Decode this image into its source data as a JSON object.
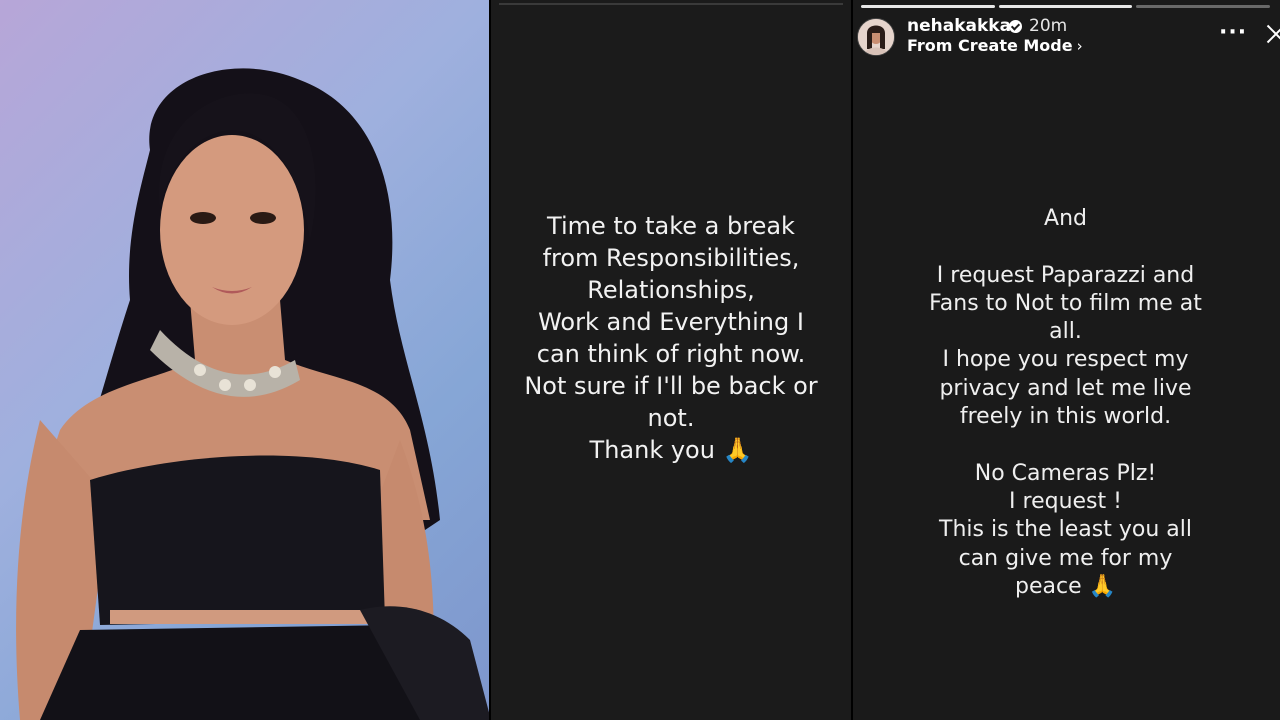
{
  "photo": {
    "alt": "portrait photo of woman in black strapless outfit"
  },
  "story_left": {
    "text": "Time to take a break\nfrom Responsibilities,\nRelationships,\nWork and Everything I\ncan think of right now.\nNot sure if I'll be back or\nnot.\nThank you 🙏"
  },
  "story_right": {
    "username": "nehakakkar",
    "time_ago": "20m",
    "sub_label": "From Create Mode",
    "chevron": "›",
    "more_label": "···",
    "text": "And\n\nI request Paparazzi and\nFans to Not to film me at\nall.\nI hope you respect my\nprivacy and let me live\nfreely in this world.\n\nNo Cameras Plz!\nI request !\nThis is the least you all\ncan give me for my\npeace 🙏"
  },
  "icons": {
    "verified": "verified-badge-icon",
    "more": "more-options-icon",
    "close": "close-icon",
    "chevron": "chevron-right-icon"
  },
  "colors": {
    "story_bg": "#1b1b1b",
    "text": "#f2f2f2",
    "photo_bg": "#9fb0de"
  }
}
